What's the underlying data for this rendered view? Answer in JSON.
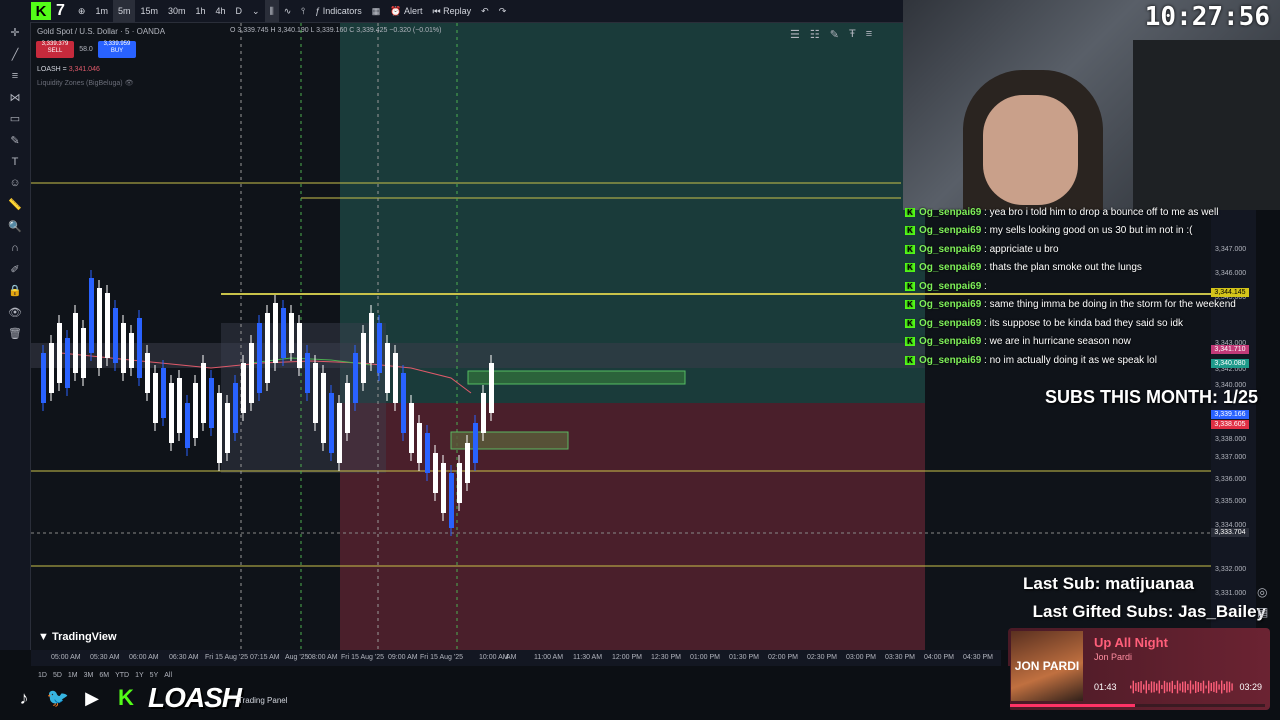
{
  "toolbar": {
    "channel_logo": "K",
    "channel_count": "7",
    "timeframes": [
      "1m",
      "5m",
      "15m",
      "30m",
      "1h",
      "4h",
      "D"
    ],
    "active_timeframe": "5m",
    "indicators_label": "Indicators",
    "alert_label": "Alert",
    "replay_label": "Replay"
  },
  "symbol": {
    "title": "Gold Spot / U.S. Dollar · 5 · OANDA",
    "ohlc": "O 3,339.745  H 3,340.190  L 3,339.160  C 3,339.425  −0.320 (−0.01%)",
    "sell_price": "3,339.379",
    "sell_label": "SELL",
    "spread": "58.0",
    "buy_price": "3,339.959",
    "buy_label": "BUY",
    "indicator1": "LOASH",
    "indicator1_value": "3,341.046",
    "indicator2": "Liquidity Zones (BigBeluga)"
  },
  "price_axis": {
    "ticks": [
      "3,347.000",
      "3,346.000",
      "3,345.000",
      "3,343.000",
      "3,342.000",
      "3,340.000",
      "3,338.000",
      "3,337.000",
      "3,336.000",
      "3,335.000",
      "3,334.000",
      "3,332.000",
      "3,331.000"
    ],
    "tag_yellow": "3,344.145",
    "tag_pink": "3,341.710",
    "tag_teal": "3,340.080",
    "tag_blue": "3,339.166",
    "tag_red": "3,338.605",
    "crosshair": "3,333.704"
  },
  "time_axis": {
    "labels": [
      "05:00 AM",
      "05:30 AM",
      "06:00 AM",
      "06:30 AM",
      "Fri 15 Aug '25",
      "07:15 AM",
      "Aug '25",
      "08:00 AM",
      "Fri 15 Aug '25",
      "09:00 AM",
      "Fri 15 Aug '25",
      "10:00 AM",
      "AM",
      "11:00 AM",
      "11:30 AM",
      "12:00 PM",
      "12:30 PM",
      "01:00 PM",
      "01:30 PM",
      "02:00 PM",
      "02:30 PM",
      "03:00 PM",
      "03:30 PM",
      "04:00 PM",
      "04:30 PM",
      "05"
    ]
  },
  "bottom_ranges": [
    "1D",
    "5D",
    "1M",
    "3M",
    "6M",
    "YTD",
    "1Y",
    "5Y",
    "All"
  ],
  "tradingview_label": "TradingView",
  "trading_panel_label": "Trading Panel",
  "stream": {
    "clock": "10:27:56",
    "subs_goal": "SUBS THIS MONTH: 1/25",
    "last_sub": "Last Sub: matijuanaa",
    "last_gifted": "Last Gifted Subs: Jas_Bailey",
    "brand": "LOASH"
  },
  "chat": [
    {
      "user": "Og_senpai69",
      "message": ": yea bro i told him to drop a bounce off to me as well"
    },
    {
      "user": "Og_senpai69",
      "message": ": my sells looking good on us 30 but im not in :("
    },
    {
      "user": "Og_senpai69",
      "message": ": appriciate u bro"
    },
    {
      "user": "Og_senpai69",
      "message": ": thats the plan smoke out the lungs"
    },
    {
      "user": "Og_senpai69",
      "message": ":"
    },
    {
      "user": "Og_senpai69",
      "message": ": same thing imma be doing in the storm for the weekend"
    },
    {
      "user": "Og_senpai69",
      "message": ": its suppose to be kinda bad they said so idk"
    },
    {
      "user": "Og_senpai69",
      "message": ": we are in hurricane season now"
    },
    {
      "user": "Og_senpai69",
      "message": ": no im actually doing it as we speak lol"
    }
  ],
  "music": {
    "title": "Up All Night",
    "artist": "Jon Pardi",
    "album_text": "JON PARDI",
    "elapsed": "01:43",
    "duration": "03:29",
    "progress_fraction": 0.49
  },
  "colors": {
    "green_zone": "#1f4a45",
    "red_zone": "#4a1f2b",
    "bull_candle": "#ffffff",
    "bear_candle": "#2962ff",
    "yellow_line": "#c8c24a",
    "kick_green": "#53fc18"
  }
}
